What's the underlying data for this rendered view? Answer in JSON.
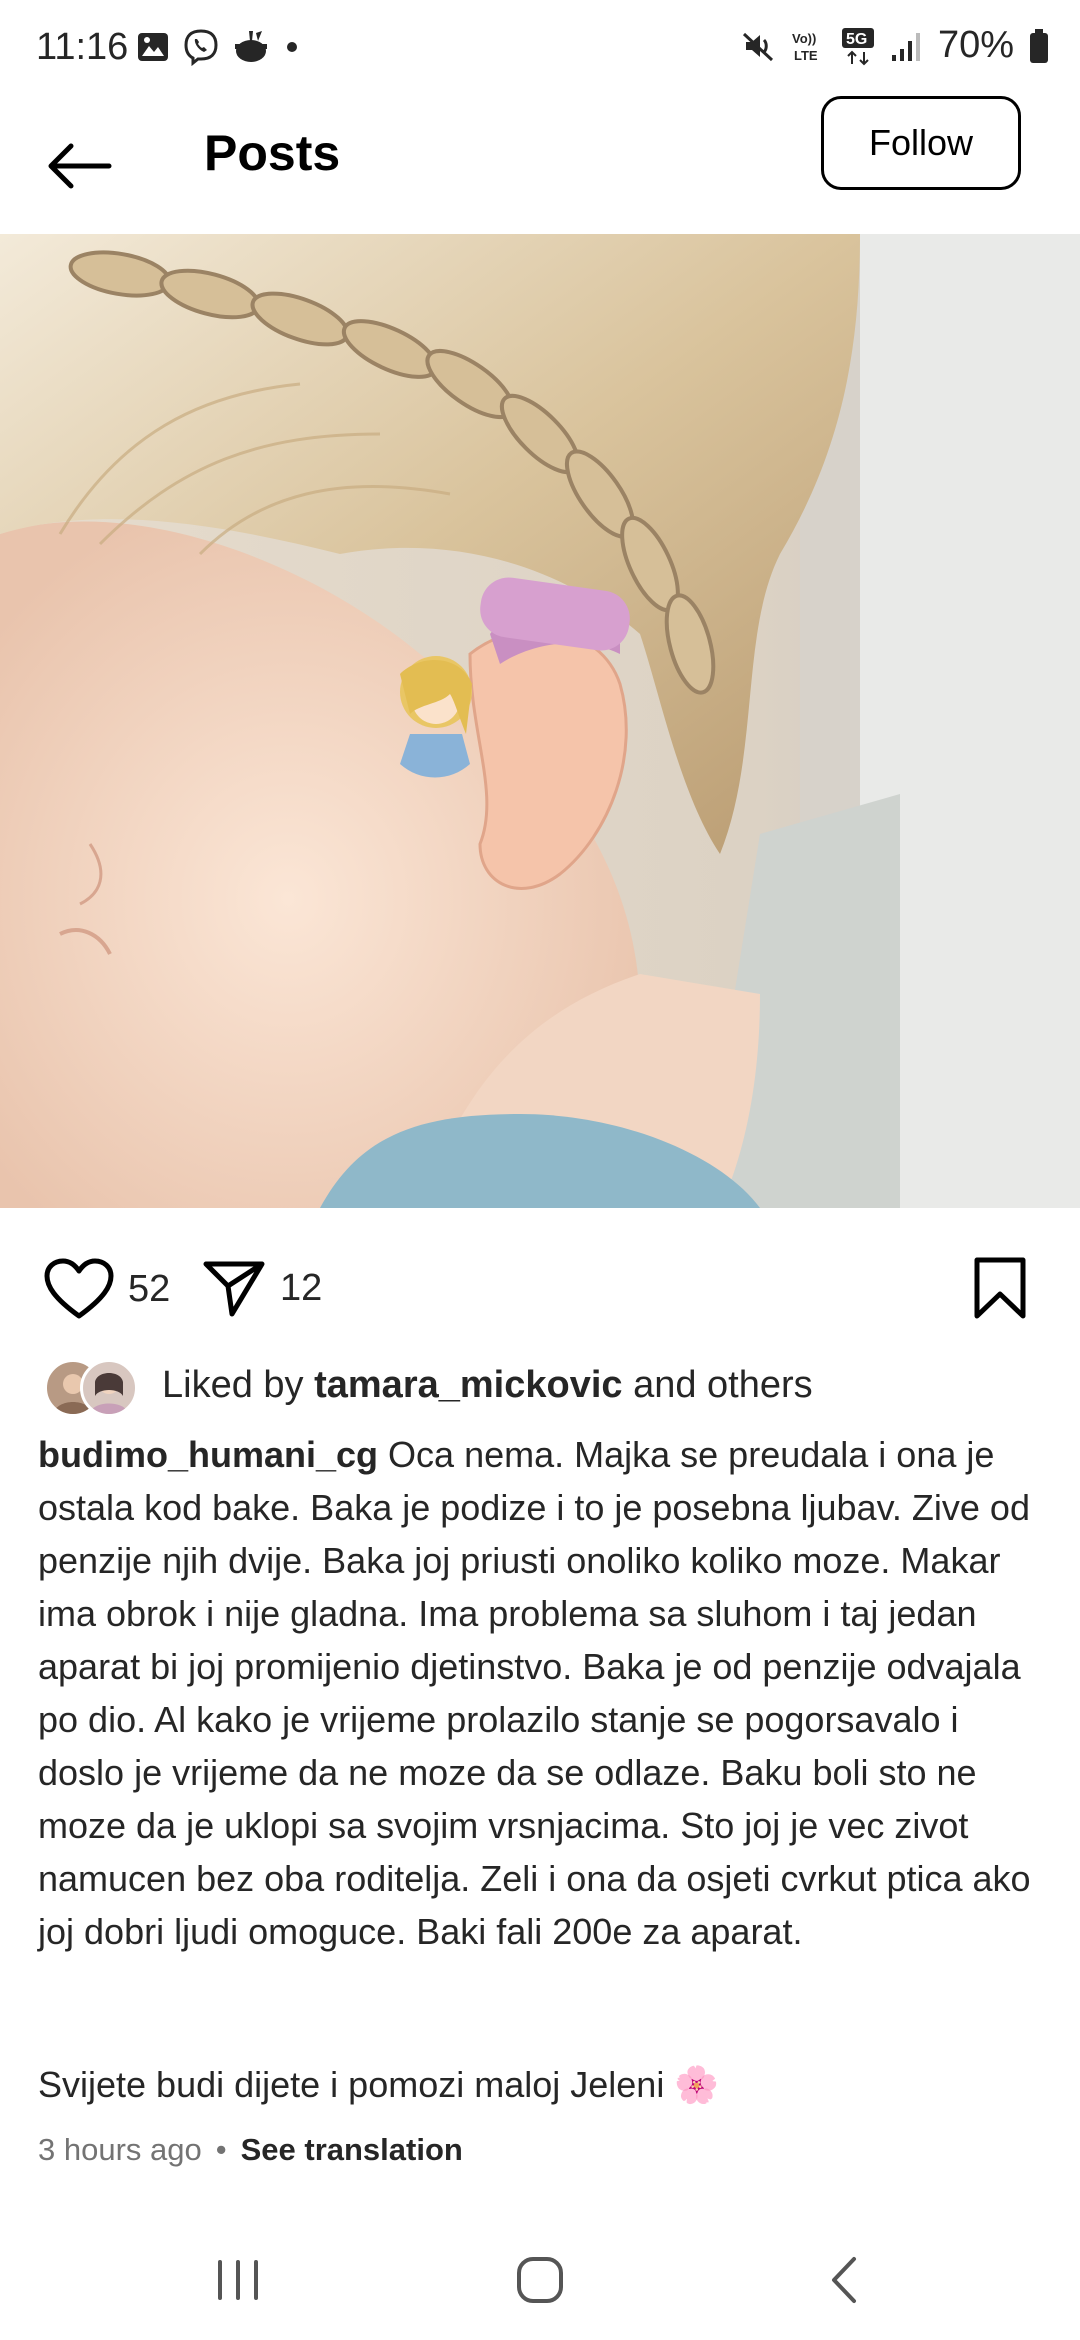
{
  "status_bar": {
    "time": "11:16",
    "network": "5G",
    "volte": "Vo)) LTE",
    "battery": "70%",
    "notification_icons": [
      "gallery-icon",
      "viber-icon",
      "cooking-icon",
      "dot-icon"
    ],
    "system_icons": [
      "mute-icon",
      "volte-icon",
      "5g-icon",
      "signal-icon",
      "battery-icon"
    ]
  },
  "header": {
    "title": "Posts",
    "follow_label": "Follow"
  },
  "post": {
    "likes": "52",
    "shares": "12",
    "liked_by_prefix": "Liked by",
    "liked_by_user": "tamara_mickovic",
    "liked_by_suffix": "and others",
    "username": "budimo_humani_cg",
    "caption": "Oca nema. Majka se preudala i ona je ostala kod bake. Baka je podize i to je posebna ljubav. Zive od penzije njih dvije. Baka joj priusti onoliko koliko moze. Makar ima obrok i nije gladna. Ima problema sa sluhom i taj jedan aparat bi joj promijenio djetinstvo. Baka je od penzije odvajala po dio. Al kako je vrijeme prolazilo stanje se pogorsavalo i doslo je vrijeme da ne moze da se odlaze. Baku boli sto ne moze da je uklopi sa svojim vrsnjacima. Sto joj je vec zivot namucen bez oba roditelja. Zeli i ona da osjeti cvrkut ptica ako joj dobri ljudi omoguce. Baki fali 200e za aparat.",
    "caption_line2": "Svijete budi dijete i pomozi maloj Jeleni",
    "emoji": "🌸",
    "time_ago": "3 hours ago",
    "separator": "•",
    "see_translation": "See translation"
  },
  "colors": {
    "text": "#262626",
    "muted": "#737373",
    "border": "#000000"
  }
}
